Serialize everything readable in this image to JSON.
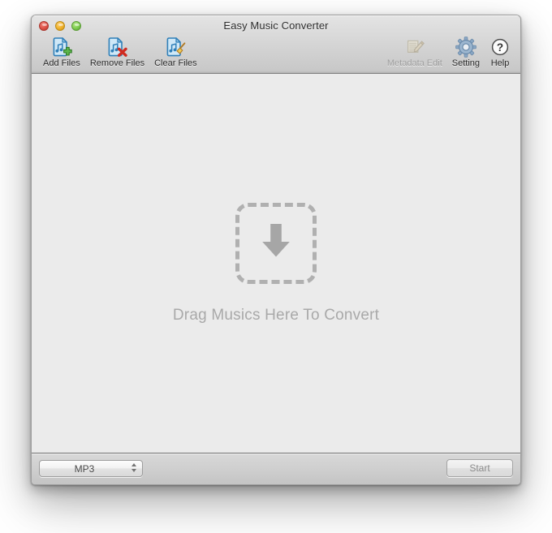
{
  "window": {
    "title": "Easy Music Converter",
    "controls": {
      "close": "close-button",
      "minimize": "minimize-button",
      "zoom": "zoom-button"
    }
  },
  "toolbar": {
    "left_items": [
      {
        "id": "add-files",
        "label": "Add Files",
        "icon": "file-music-add-icon",
        "enabled": true
      },
      {
        "id": "remove-files",
        "label": "Remove Files",
        "icon": "file-music-remove-icon",
        "enabled": true
      },
      {
        "id": "clear-files",
        "label": "Clear Files",
        "icon": "file-music-broom-icon",
        "enabled": true
      }
    ],
    "right_items": [
      {
        "id": "metadata-edit",
        "label": "Metadata Edit",
        "icon": "list-pencil-icon",
        "enabled": false
      },
      {
        "id": "setting",
        "label": "Setting",
        "icon": "gear-icon",
        "enabled": true
      },
      {
        "id": "help",
        "label": "Help",
        "icon": "question-mark-icon",
        "enabled": true
      }
    ]
  },
  "content": {
    "drop_caption": "Drag Musics Here To Convert",
    "drop_icon": "download-arrow-icon"
  },
  "bottombar": {
    "format_popup": {
      "value": "MP3",
      "options": [
        "MP3"
      ]
    },
    "start_label": "Start",
    "start_enabled": false
  },
  "colors": {
    "accent_blue": "#3d8fd1",
    "add_green": "#5cb64a",
    "remove_red": "#d02b20",
    "broom_yellow": "#e8bb3c",
    "text": "#2b2b2b",
    "disabled_text": "#9d9d9d",
    "content_bg": "#ebebeb",
    "dropzone_gray": "#b0b0b0"
  }
}
